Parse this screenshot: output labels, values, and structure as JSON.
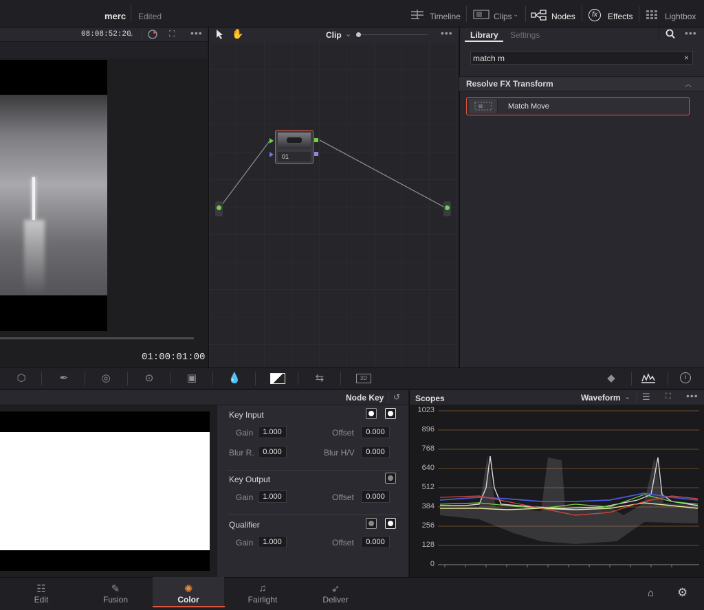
{
  "topbar": {
    "project_name": "merc",
    "project_status": "Edited",
    "items": [
      {
        "label": "Timeline",
        "icon": "timeline-icon"
      },
      {
        "label": "Clips",
        "icon": "clips-icon"
      },
      {
        "label": "Nodes",
        "icon": "nodes-icon"
      },
      {
        "label": "Effects",
        "icon": "effects-fx-icon"
      },
      {
        "label": "Lightbox",
        "icon": "lightbox-icon"
      }
    ]
  },
  "viewer": {
    "timecode_top": "08:08:52:20",
    "timecode_bottom": "01:00:01:00"
  },
  "node_editor": {
    "mode_label": "Clip",
    "node_label": "01"
  },
  "library": {
    "tab_active": "Library",
    "tab_inactive": "Settings",
    "search_value": "match m",
    "search_clear": "×",
    "section_title": "Resolve FX Transform",
    "result_item": "Match Move"
  },
  "key_panel": {
    "title": "Node Key",
    "key_input": {
      "title": "Key Input",
      "gain_label": "Gain",
      "gain_value": "1.000",
      "offset_label": "Offset",
      "offset_value": "0.000",
      "blur_r_label": "Blur R.",
      "blur_r_value": "0.000",
      "blur_hv_label": "Blur H/V",
      "blur_hv_value": "0.000"
    },
    "key_output": {
      "title": "Key Output",
      "gain_label": "Gain",
      "gain_value": "1.000",
      "offset_label": "Offset",
      "offset_value": "0.000"
    },
    "qualifier": {
      "title": "Qualifier",
      "gain_label": "Gain",
      "gain_value": "1.000",
      "offset_label": "Offset",
      "offset_value": "0.000"
    }
  },
  "scopes": {
    "title": "Scopes",
    "mode": "Waveform",
    "ticks": [
      "1023",
      "896",
      "768",
      "640",
      "512",
      "384",
      "256",
      "128",
      "0"
    ]
  },
  "pagebar": {
    "pages": [
      {
        "label": "Edit",
        "icon": "edit-page-icon"
      },
      {
        "label": "Fusion",
        "icon": "fusion-page-icon"
      },
      {
        "label": "Color",
        "icon": "color-page-icon",
        "active": true
      },
      {
        "label": "Fairlight",
        "icon": "fairlight-page-icon"
      },
      {
        "label": "Deliver",
        "icon": "deliver-page-icon"
      }
    ]
  },
  "colors": {
    "accent": "#e0553f",
    "node_link_green": "#6fd14a"
  }
}
